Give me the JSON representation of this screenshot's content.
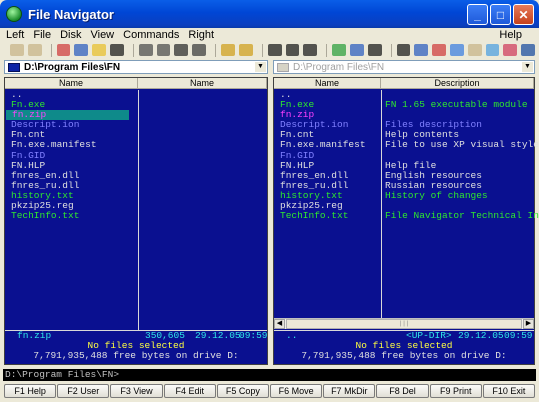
{
  "window": {
    "title": "File Navigator"
  },
  "menu": {
    "left": "Left",
    "file": "File",
    "disk": "Disk",
    "view": "View",
    "commands": "Commands",
    "right": "Right",
    "help": "Help"
  },
  "toolbar": {
    "icons": [
      "brief-view-icon",
      "full-view-icon",
      "copy-icon",
      "move-icon",
      "new-folder-icon",
      "delete-icon",
      "view-icon",
      "edit-icon",
      "find-icon",
      "print-icon",
      "help-icon",
      "filter-icon",
      "select-icon",
      "deselect-icon",
      "invert-icon",
      "compare-icon",
      "sync-icon",
      "command-icon",
      "swap-icon",
      "pack-icon",
      "unpack-icon",
      "notes-icon",
      "archive-icon",
      "split-icon",
      "tools-icon",
      "network-icon"
    ]
  },
  "left_panel": {
    "path": "D:\\Program Files\\FN",
    "col_headers": [
      "Name",
      "Name"
    ],
    "files": [
      {
        "name": "..",
        "color": "#e0e0e0"
      },
      {
        "name": "Fn.exe",
        "color": "#2ee82e"
      },
      {
        "name": "fn.zip",
        "color": "#ff40ff",
        "selected": true
      },
      {
        "name": "Descript.ion",
        "color": "#8080ff"
      },
      {
        "name": "Fn.cnt",
        "color": "#e0e0e0"
      },
      {
        "name": "Fn.exe.manifest",
        "color": "#e0e0e0"
      },
      {
        "name": "Fn.GID",
        "color": "#8080ff"
      },
      {
        "name": "FN.HLP",
        "color": "#e0e0e0"
      },
      {
        "name": "fnres_en.dll",
        "color": "#e0e0e0"
      },
      {
        "name": "fnres_ru.dll",
        "color": "#e0e0e0"
      },
      {
        "name": "history.txt",
        "color": "#2ee82e"
      },
      {
        "name": "pkzip25.reg",
        "color": "#e0e0e0"
      },
      {
        "name": "TechInfo.txt",
        "color": "#2ee82e"
      }
    ],
    "current_file": "fn.zip",
    "current_size": "350,605",
    "current_date": "29.12.05",
    "current_time": "09:59",
    "selection_status": "No files selected",
    "free_space": "7,791,935,488 free bytes on drive D:"
  },
  "right_panel": {
    "path": "D:\\Program Files\\FN",
    "col_headers": [
      "Name",
      "Description"
    ],
    "files": [
      {
        "name": "..",
        "desc": "",
        "color": "#e0e0e0"
      },
      {
        "name": "Fn.exe",
        "desc": "FN 1.65 executable module",
        "color": "#2ee82e"
      },
      {
        "name": "fn.zip",
        "desc": "",
        "color": "#ff40ff"
      },
      {
        "name": "Descript.ion",
        "desc": "Files description",
        "color": "#8080ff"
      },
      {
        "name": "Fn.cnt",
        "desc": "Help contents",
        "color": "#e0e0e0"
      },
      {
        "name": "Fn.exe.manifest",
        "desc": "File to use XP visual styles",
        "color": "#e0e0e0"
      },
      {
        "name": "Fn.GID",
        "desc": "",
        "color": "#8080ff"
      },
      {
        "name": "FN.HLP",
        "desc": "Help file",
        "color": "#e0e0e0"
      },
      {
        "name": "fnres_en.dll",
        "desc": "English resources",
        "color": "#e0e0e0"
      },
      {
        "name": "fnres_ru.dll",
        "desc": "Russian resources",
        "color": "#e0e0e0"
      },
      {
        "name": "history.txt",
        "desc": "History of changes",
        "color": "#2ee82e"
      },
      {
        "name": "pkzip25.reg",
        "desc": "",
        "color": "#e0e0e0"
      },
      {
        "name": "TechInfo.txt",
        "desc": "File Navigator Technical Infor",
        "color": "#2ee82e"
      }
    ],
    "current_file": "..",
    "current_type": "<UP-DIR>",
    "current_date": "29.12.05",
    "current_time": "09:59",
    "selection_status": "No files selected",
    "free_space": "7,791,935,488 free bytes on drive D:"
  },
  "command_line": {
    "prompt": "D:\\Program Files\\FN>"
  },
  "fkeys": [
    "F1 Help",
    "F2 User",
    "F3 View",
    "F4 Edit",
    "F5 Copy",
    "F6 Move",
    "F7 MkDir",
    "F8 Del",
    "F9 Print",
    "F10 Exit"
  ],
  "colors": {
    "panel_bg": "#0a1090",
    "cursor_bg": "#0e8a8a",
    "info_cyan": "#2ee8e8",
    "info_yellow": "#ffff40"
  }
}
